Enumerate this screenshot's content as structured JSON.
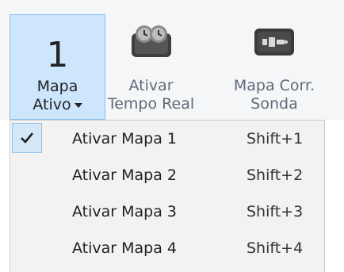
{
  "ribbon": {
    "active_map": {
      "number": "1",
      "label_line1": "Mapa",
      "label_line2": "Ativo",
      "icon": "chevron-down-icon"
    },
    "realtime": {
      "label_line1": "Ativar",
      "label_line2": "Tempo Real",
      "icon": "ecu-clock-icon"
    },
    "probe_map": {
      "label_line1": "Mapa Corr.",
      "label_line2": "Sonda",
      "icon": "probe-module-icon"
    }
  },
  "menu": {
    "items": [
      {
        "label": "Ativar Mapa 1",
        "shortcut": "Shift+1",
        "checked": true
      },
      {
        "label": "Ativar Mapa 2",
        "shortcut": "Shift+2",
        "checked": false
      },
      {
        "label": "Ativar Mapa 3",
        "shortcut": "Shift+3",
        "checked": false
      },
      {
        "label": "Ativar Mapa 4",
        "shortcut": "Shift+4",
        "checked": false
      }
    ],
    "check_icon": "checkmark-icon"
  },
  "colors": {
    "active_fill": "#cde6fb",
    "active_border": "#87bff0",
    "ribbon_bg": "#f5f6f7",
    "menu_bg": "#f2f2f2"
  }
}
